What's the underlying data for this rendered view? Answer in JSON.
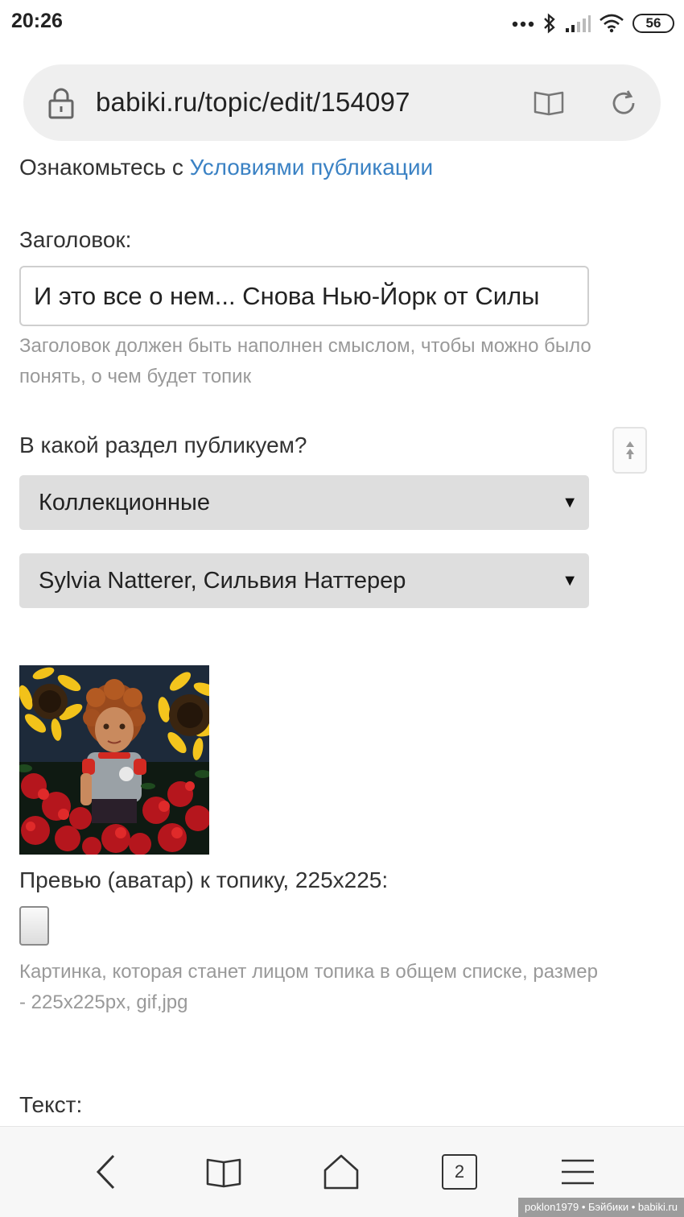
{
  "status_bar": {
    "time": "20:26",
    "battery": "56",
    "icons": [
      "more-dots-icon",
      "bluetooth-icon",
      "signal-icon",
      "wifi-icon",
      "battery-icon"
    ]
  },
  "browser": {
    "url": "babiki.ru/topic/edit/154097",
    "icons": [
      "lock-icon",
      "reader-mode-icon",
      "reload-icon"
    ]
  },
  "form": {
    "terms_prefix": "Ознакомьтесь с",
    "terms_link": "Условиями публикации",
    "title_label": "Заголовок:",
    "title_value": "И это все о нем... Снова Нью-Йорк от Силы",
    "title_hint": "Заголовок должен быть наполнен смыслом, чтобы можно было понять, о чем будет топик",
    "section_label": "В какой раздел публикуем?",
    "section_select": "Коллекционные",
    "subsection_select": "Sylvia Natterer, Сильвия Наттерер",
    "preview_label": "Превью (аватар) к топику, 225x225:",
    "preview_hint": "Картинка, которая станет лицом топика в общем списке, размер - 225x225px, gif,jpg",
    "text_label": "Текст:"
  },
  "bottom_nav": {
    "tabs_count": "2",
    "icons": [
      "back-icon",
      "bookmarks-icon",
      "home-icon",
      "tabs-icon",
      "menu-icon"
    ]
  },
  "watermark": "poklon1979 • Бэйбики • babiki.ru",
  "colors": {
    "link": "#3b82c4",
    "hint_text": "#999999",
    "select_bg": "#dedede",
    "url_bar_bg": "#efefef"
  }
}
